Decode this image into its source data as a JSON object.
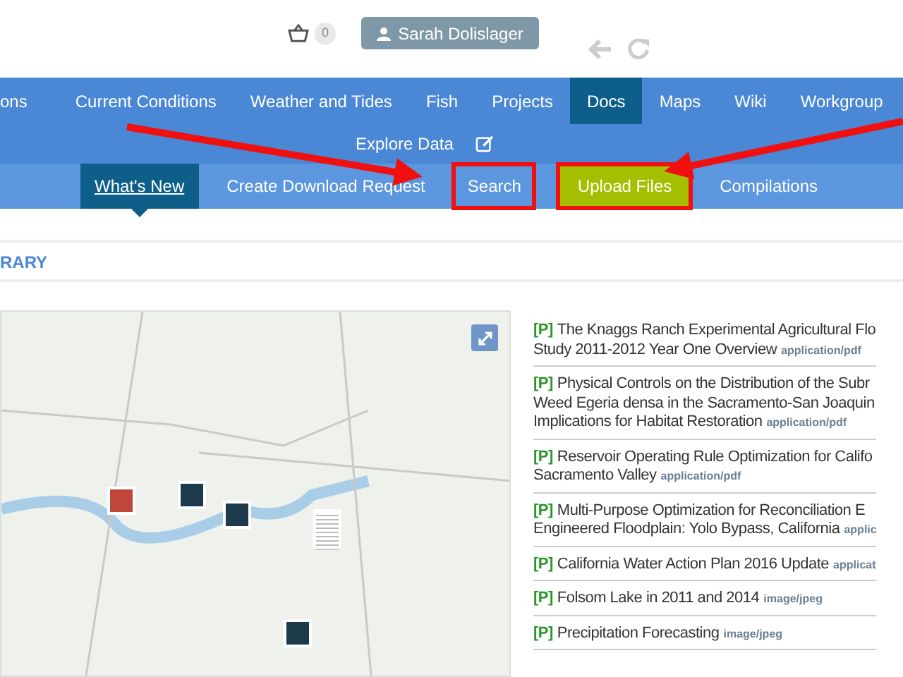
{
  "header": {
    "cart_count": "0",
    "user_name": "Sarah Dolislager"
  },
  "nav": {
    "items": [
      {
        "label": "ons",
        "selected": false
      },
      {
        "label": "Current Conditions",
        "selected": false
      },
      {
        "label": "Weather and Tides",
        "selected": false
      },
      {
        "label": "Fish",
        "selected": false
      },
      {
        "label": "Projects",
        "selected": false
      },
      {
        "label": "Docs",
        "selected": true
      },
      {
        "label": "Maps",
        "selected": false
      },
      {
        "label": "Wiki",
        "selected": false
      },
      {
        "label": "Workgroup",
        "selected": false
      }
    ],
    "second_row": {
      "label": "Explore Data"
    }
  },
  "subnav": {
    "items": [
      {
        "label": "What's New",
        "selected": true,
        "highlighted": false,
        "kind": "tab"
      },
      {
        "label": "Create Download Request",
        "selected": false,
        "highlighted": false,
        "kind": "tab"
      },
      {
        "label": "Search",
        "selected": false,
        "highlighted": true,
        "kind": "tab"
      },
      {
        "label": "Upload Files",
        "selected": false,
        "highlighted": true,
        "kind": "button"
      },
      {
        "label": "Compilations",
        "selected": false,
        "highlighted": false,
        "kind": "tab"
      }
    ]
  },
  "section": {
    "title": "RARY"
  },
  "documents": [
    {
      "tag": "[P]",
      "lines": [
        "The Knaggs Ranch Experimental Agricultural Flo",
        "Study 2011-2012 Year One Overview"
      ],
      "type": "application/pdf"
    },
    {
      "tag": "[P]",
      "lines": [
        "Physical Controls on the Distribution of the Subr",
        "Weed Egeria densa in the Sacramento-San Joaquin",
        "Implications for Habitat Restoration"
      ],
      "type": "application/pdf"
    },
    {
      "tag": "[P]",
      "lines": [
        "Reservoir Operating Rule Optimization for Califo",
        "Sacramento Valley"
      ],
      "type": "application/pdf"
    },
    {
      "tag": "[P]",
      "lines": [
        "Multi-Purpose Optimization for Reconciliation E",
        "Engineered Floodplain: Yolo Bypass, California"
      ],
      "type": "applic"
    },
    {
      "tag": "[P]",
      "lines": [
        "California Water Action Plan 2016 Update"
      ],
      "type": "applicat"
    },
    {
      "tag": "[P]",
      "lines": [
        "Folsom Lake in 2011 and 2014"
      ],
      "type": "image/jpeg"
    },
    {
      "tag": "[P]",
      "lines": [
        "Precipitation Forecasting"
      ],
      "type": "image/jpeg"
    }
  ]
}
